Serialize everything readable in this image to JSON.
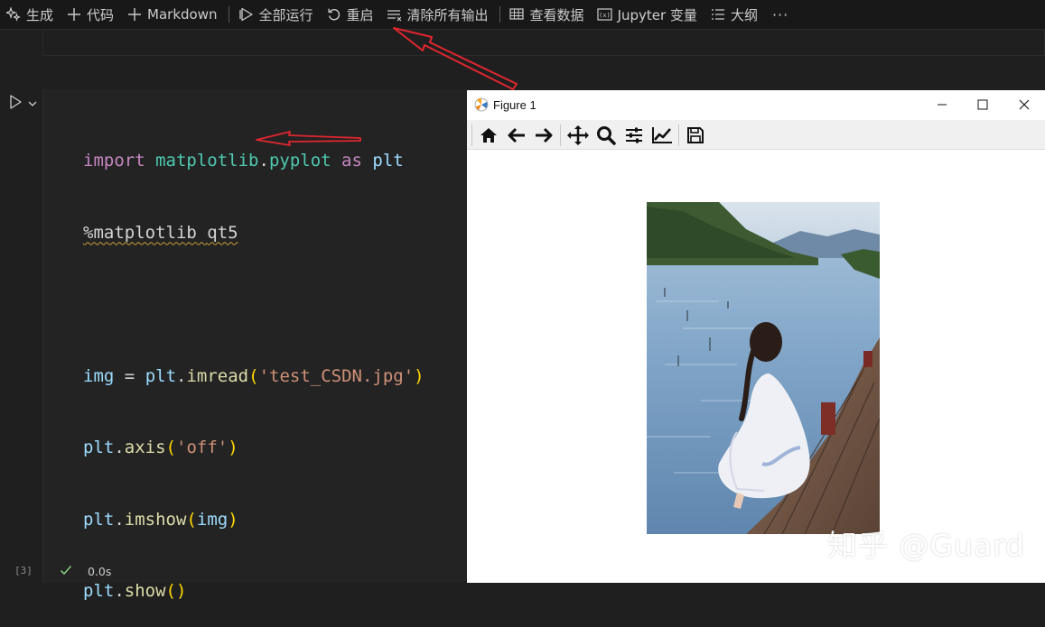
{
  "toolbar": {
    "items": [
      {
        "label": "生成",
        "icon": "sparkle-icon"
      },
      {
        "label": "代码",
        "icon": "plus-icon"
      },
      {
        "label": "Markdown",
        "icon": "plus-icon"
      },
      {
        "label": "全部运行",
        "icon": "run-all-icon"
      },
      {
        "label": "重启",
        "icon": "restart-icon"
      },
      {
        "label": "清除所有输出",
        "icon": "clear-outputs-icon"
      },
      {
        "label": "查看数据",
        "icon": "data-viewer-icon"
      },
      {
        "label": "Jupyter 变量",
        "icon": "variables-icon"
      },
      {
        "label": "大纲",
        "icon": "outline-icon"
      }
    ],
    "more_label": "···"
  },
  "cell": {
    "code_lines": [
      "import matplotlib.pyplot as plt",
      "%matplotlib qt5",
      "",
      "img = plt.imread('test_CSDN.jpg')",
      "plt.axis('off')",
      "plt.imshow(img)",
      "plt.show()"
    ],
    "exec_count": "[3]",
    "exec_time": "0.0s"
  },
  "figure": {
    "title": "Figure 1",
    "toolbar_icons": [
      "home-icon",
      "back-icon",
      "forward-icon",
      "pan-icon",
      "zoom-icon",
      "configure-subplots-icon",
      "edit-axes-icon",
      "save-icon"
    ]
  },
  "watermark": "知乎 @Guard",
  "colors": {
    "accent_arrow": "#e0262f",
    "editor_bg": "#1f1f1f"
  }
}
